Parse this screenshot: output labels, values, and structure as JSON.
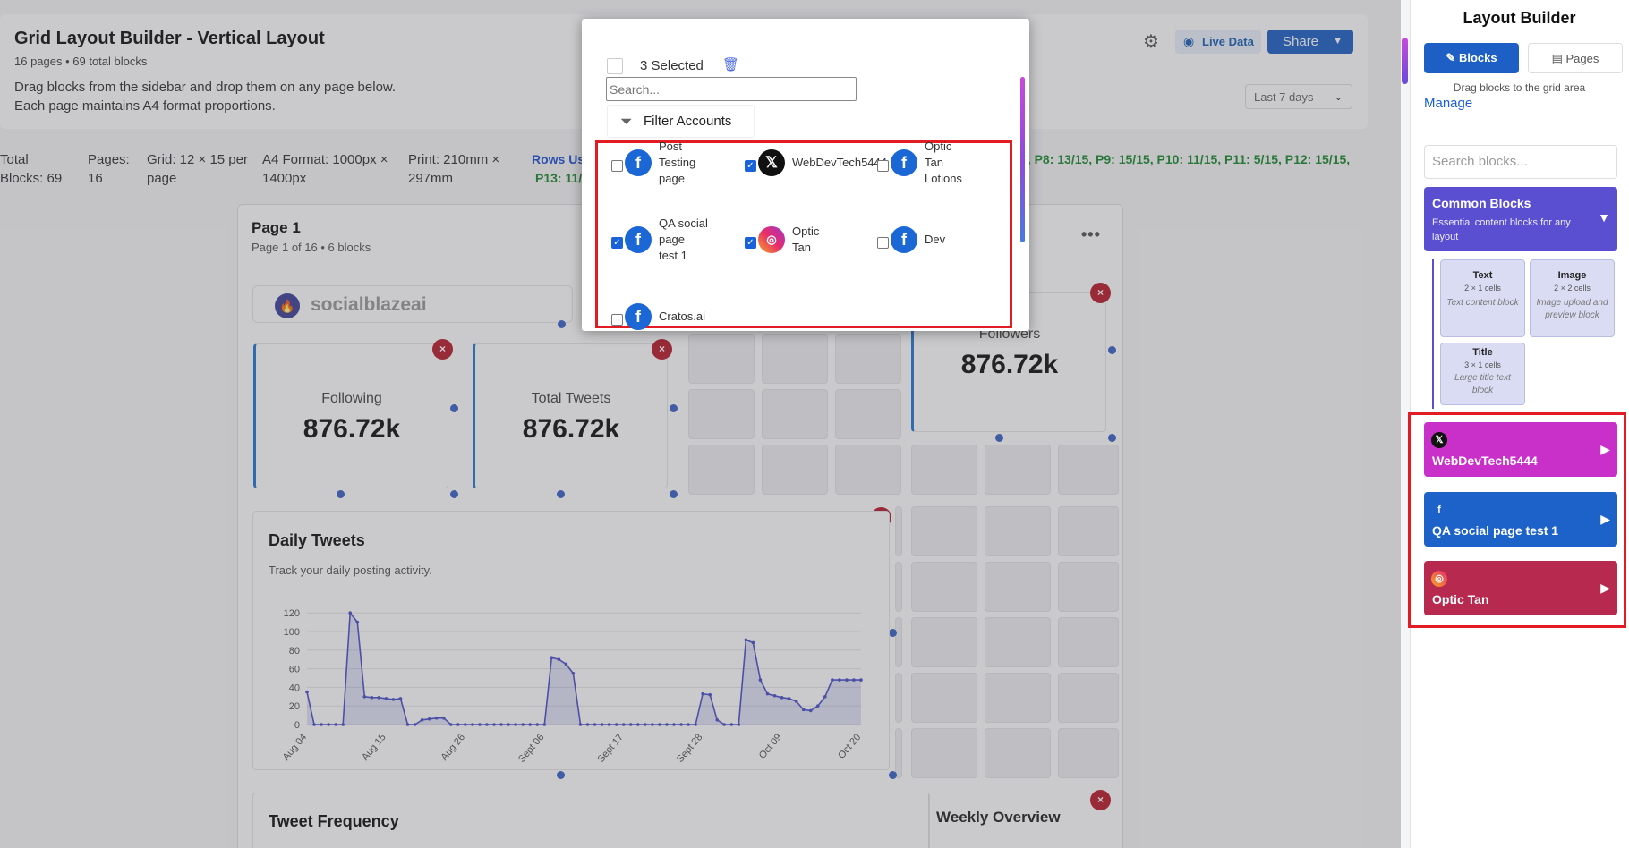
{
  "header": {
    "title": "Grid Layout Builder - Vertical Layout",
    "subtitle": "16 pages • 69 total blocks",
    "description": "Drag blocks from the sidebar and drop them on any page below.\nEach page maintains A4 format proportions.",
    "live_data_label": "Live Data",
    "share_label": "Share",
    "date_range": "Last 7 days"
  },
  "stats": {
    "total_blocks": "Total\nBlocks: 69",
    "pages": "Pages:\n16",
    "grid": "Grid: 12 × 15 per\npage",
    "a4_format": "A4 Format: 1000px ×\n1400px",
    "print": "Print: 210mm ×\n297mm",
    "rows_used_label": "Rows Us",
    "pages_line1": "5,  P8: 13/15,  P9: 15/15,  P10: 11/15,  P11: 5/15,  P12: 15/15,",
    "pages_line2": "P13: 11/1"
  },
  "page": {
    "title": "Page 1",
    "subtitle": "Page 1 of 16 • 6 blocks",
    "logo_text": "socialblazeai",
    "stat_cards": [
      {
        "label": "Following",
        "value": "876.72k"
      },
      {
        "label": "Total Tweets",
        "value": "876.72k"
      },
      {
        "label": "Followers",
        "value": "876.72k"
      }
    ],
    "daily_tweets": {
      "title": "Daily Tweets",
      "subtitle": "Track your daily posting activity."
    },
    "tweet_frequency_title": "Tweet Frequency",
    "weekly_overview_title": "Weekly Overview"
  },
  "modal": {
    "selected_label": "3 Selected",
    "search_placeholder": "Search...",
    "filter_label": "Filter Accounts",
    "accounts": [
      {
        "name": "Post\nTesting\npage",
        "platform": "facebook",
        "checked": false
      },
      {
        "name": "WebDevTech5444",
        "platform": "x",
        "checked": true
      },
      {
        "name": "Optic\nTan\nLotions",
        "platform": "facebook",
        "checked": false
      },
      {
        "name": "QA social\npage\ntest 1",
        "platform": "facebook",
        "checked": true
      },
      {
        "name": "Optic\nTan",
        "platform": "instagram",
        "checked": true
      },
      {
        "name": "Dev",
        "platform": "facebook",
        "checked": false
      },
      {
        "name": "Cratos.ai",
        "platform": "facebook",
        "checked": false
      }
    ]
  },
  "sidebar": {
    "title": "Layout Builder",
    "tab_blocks": "Blocks",
    "tab_pages": "Pages",
    "help_text": "Drag blocks to the grid area",
    "manage_label": "Manage",
    "search_placeholder": "Search blocks...",
    "common": {
      "title": "Common Blocks",
      "description": "Essential content blocks for any layout"
    },
    "blocks": [
      {
        "title": "Text",
        "cells": "2 × 1 cells",
        "desc": "Text content block"
      },
      {
        "title": "Image",
        "cells": "2 × 2 cells",
        "desc": "Image upload and preview block"
      },
      {
        "title": "Title",
        "cells": "3 × 1 cells",
        "desc": "Large title text block"
      }
    ],
    "accounts": [
      {
        "name": "WebDevTech5444",
        "platform": "x",
        "color": "#c92fc9"
      },
      {
        "name": "QA social page test 1",
        "platform": "facebook",
        "color": "#1d62c9"
      },
      {
        "name": "Optic Tan",
        "platform": "instagram",
        "color": "#b8294f"
      }
    ]
  },
  "chart_data": {
    "type": "line",
    "title": "",
    "x": [
      "Aug 04",
      "Aug 05",
      "Aug 06",
      "Aug 07",
      "Aug 08",
      "Aug 09",
      "Aug 10",
      "Aug 11",
      "Aug 12",
      "Aug 13",
      "Aug 14",
      "Aug 15",
      "Aug 16",
      "Aug 17",
      "Aug 18",
      "Aug 19",
      "Aug 20",
      "Aug 21",
      "Aug 22",
      "Aug 23",
      "Aug 24",
      "Aug 25",
      "Aug 26",
      "Aug 27",
      "Aug 28",
      "Aug 29",
      "Aug 30",
      "Aug 31",
      "Sept 01",
      "Sept 02",
      "Sept 03",
      "Sept 04",
      "Sept 05",
      "Sept 06",
      "Sept 07",
      "Sept 08",
      "Sept 09",
      "Sept 10",
      "Sept 11",
      "Sept 12",
      "Sept 13",
      "Sept 14",
      "Sept 15",
      "Sept 16",
      "Sept 17",
      "Sept 18",
      "Sept 19",
      "Sept 20",
      "Sept 21",
      "Sept 22",
      "Sept 23",
      "Sept 24",
      "Sept 25",
      "Sept 26",
      "Sept 27",
      "Sept 28",
      "Sept 29",
      "Sept 30",
      "Oct 01",
      "Oct 02",
      "Oct 03",
      "Oct 04",
      "Oct 05",
      "Oct 06",
      "Oct 07",
      "Oct 08",
      "Oct 09",
      "Oct 10",
      "Oct 11",
      "Oct 12",
      "Oct 13",
      "Oct 14",
      "Oct 15",
      "Oct 16",
      "Oct 17",
      "Oct 18",
      "Oct 19",
      "Oct 20"
    ],
    "values": [
      35,
      0,
      0,
      0,
      0,
      0,
      120,
      110,
      30,
      29,
      29,
      28,
      27,
      28,
      0,
      0,
      5,
      6,
      7,
      7,
      0,
      0,
      0,
      0,
      0,
      0,
      0,
      0,
      0,
      0,
      0,
      0,
      0,
      0,
      72,
      70,
      65,
      55,
      0,
      0,
      0,
      0,
      0,
      0,
      0,
      0,
      0,
      0,
      0,
      0,
      0,
      0,
      0,
      0,
      0,
      33,
      32,
      5,
      0,
      0,
      0,
      91,
      88,
      48,
      33,
      31,
      29,
      28,
      25,
      16,
      15,
      20,
      30,
      48,
      48,
      48,
      48,
      48
    ],
    "x_tick_labels": [
      "Aug 04",
      "Aug 15",
      "Aug 26",
      "Sept 06",
      "Sept 17",
      "Sept 28",
      "Oct 09",
      "Oct 20"
    ],
    "y_ticks": [
      0,
      20,
      40,
      60,
      80,
      100,
      120
    ],
    "ylim": [
      0,
      125
    ],
    "color": "#4b4fc9"
  }
}
